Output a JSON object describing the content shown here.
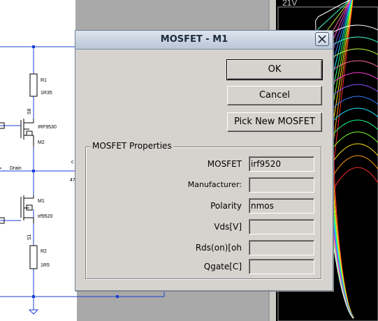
{
  "schematic": {
    "r1_name": "R1",
    "r1_value": "1R35",
    "m2_name": "M2",
    "m2_model": "IRF9530",
    "m1_name": "M1",
    "m1_model": "irf9520",
    "r2_name": "R2",
    "r2_value": "1R5",
    "drain_label": "Drain",
    "source_label_top": "S8",
    "source_label_bottom": "S1",
    "edge_label_c": "c",
    "edge_label_47": "47"
  },
  "scope": {
    "voltage_label": "21V"
  },
  "dialog": {
    "title": "MOSFET - M1",
    "ok_label": "OK",
    "cancel_label": "Cancel",
    "pick_label": "Pick New MOSFET",
    "group_label": "MOSFET Properties",
    "properties": [
      {
        "label": "MOSFET",
        "value": "irf9520"
      },
      {
        "label": "Manufacturer:",
        "value": ""
      },
      {
        "label": "Polarity",
        "value": "nmos"
      },
      {
        "label": "Vds[V]",
        "value": ""
      },
      {
        "label": "Rds(on)[oh",
        "value": ""
      },
      {
        "label": "Qgate[C]",
        "value": ""
      }
    ]
  },
  "colors": {
    "schematic_bg": "#ffffff",
    "grid_area": "#a8a8a8",
    "wire": "#1c3fd6",
    "scope_bg": "#000000",
    "dialog_bg": "#d6d3ce"
  }
}
